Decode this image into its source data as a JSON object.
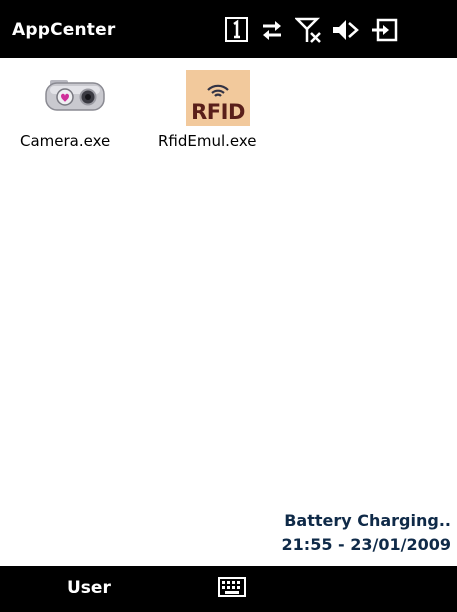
{
  "titlebar": {
    "title": "AppCenter",
    "icons": [
      "phone-line-1-icon",
      "sync-arrows-icon",
      "no-signal-icon",
      "speaker-muted-icon",
      "battery-charging-plug-icon"
    ]
  },
  "desktop": {
    "apps": [
      {
        "label": "Camera.exe",
        "icon": "camera-icon"
      },
      {
        "label": "RfidEmul.exe",
        "icon": "rfid-icon",
        "icon_text": "RFID"
      }
    ]
  },
  "status": {
    "line1": "Battery Charging..",
    "line2": "21:55 - 23/01/2009"
  },
  "softbar": {
    "left_label": "User",
    "keyboard_icon": "keyboard-icon"
  },
  "colors": {
    "bar_background": "#000000",
    "status_text": "#0f2a48",
    "rfid_tile": "#f2c99c"
  }
}
